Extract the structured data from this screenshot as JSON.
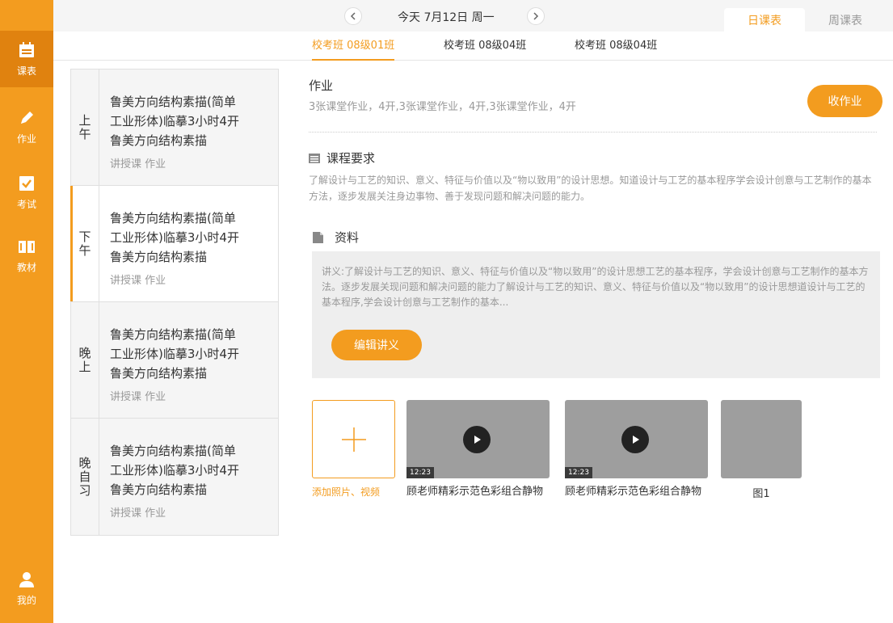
{
  "sidebar": {
    "items": [
      {
        "label": "课表",
        "icon": "calendar-icon"
      },
      {
        "label": "作业",
        "icon": "pencil-icon"
      },
      {
        "label": "考试",
        "icon": "checkbox-icon"
      },
      {
        "label": "教材",
        "icon": "book-icon"
      },
      {
        "label": "我的",
        "icon": "user-icon"
      }
    ],
    "active": "课表",
    "bg_color": "#F39C1F"
  },
  "topbar": {
    "date": "今天 7月12日 周一",
    "views": [
      "日课表",
      "周课表"
    ],
    "active_view": "日课表"
  },
  "class_tabs": [
    "校考班 08级01班",
    "校考班 08级04班",
    "校考班 08级04班"
  ],
  "active_class": "校考班 08级01班",
  "schedule": [
    {
      "period": "上午",
      "title_lines": [
        "鲁美方向结构素描(简单",
        "工业形体)临摹3小时4开",
        "鲁美方向结构素描"
      ],
      "meta": "讲授课 作业"
    },
    {
      "period": "下午",
      "title_lines": [
        "鲁美方向结构素描(简单",
        "工业形体)临摹3小时4开",
        "鲁美方向结构素描"
      ],
      "meta": "讲授课 作业"
    },
    {
      "period": "晚上",
      "title_lines": [
        "鲁美方向结构素描(简单",
        "工业形体)临摹3小时4开",
        "鲁美方向结构素描"
      ],
      "meta": "讲授课 作业"
    },
    {
      "period": "晚自习",
      "title_lines": [
        "鲁美方向结构素描(简单",
        "工业形体)临摹3小时4开",
        "鲁美方向结构素描"
      ],
      "meta": "讲授课 作业"
    }
  ],
  "active_slot": "下午",
  "homework": {
    "title": "作业",
    "description": "3张课堂作业，4开,3张课堂作业，4开,3张课堂作业，4开",
    "collect_button": "收作业"
  },
  "course_requirements": {
    "title": "课程要求",
    "text": "了解设计与工艺的知识、意义、特征与价值以及“物以致用”的设计思想。知道设计与工艺的基本程序学会设计创意与工艺制作的基本方法，逐步发展关注身边事物、善于发现问题和解决问题的能力。"
  },
  "materials": {
    "title": "资料",
    "text": "讲义:了解设计与工艺的知识、意义、特征与价值以及“物以致用”的设计思想工艺的基本程序，学会设计创意与工艺制作的基本方法。逐步发展关现问题和解决问题的能力了解设计与工艺的知识、意义、特征与价值以及“物以致用”的设计思想道设计与工艺的基本程序,学会设计创意与工艺制作的基本...",
    "edit_button": "编辑讲义"
  },
  "media": {
    "add_label": "添加照片、视频",
    "videos": [
      {
        "duration": "12:23",
        "caption": "顾老师精彩示范色彩组合静物"
      },
      {
        "duration": "12:23",
        "caption": "顾老师精彩示范色彩组合静物"
      }
    ],
    "image_caption": "图1"
  },
  "accent_color": "#F39C1F"
}
